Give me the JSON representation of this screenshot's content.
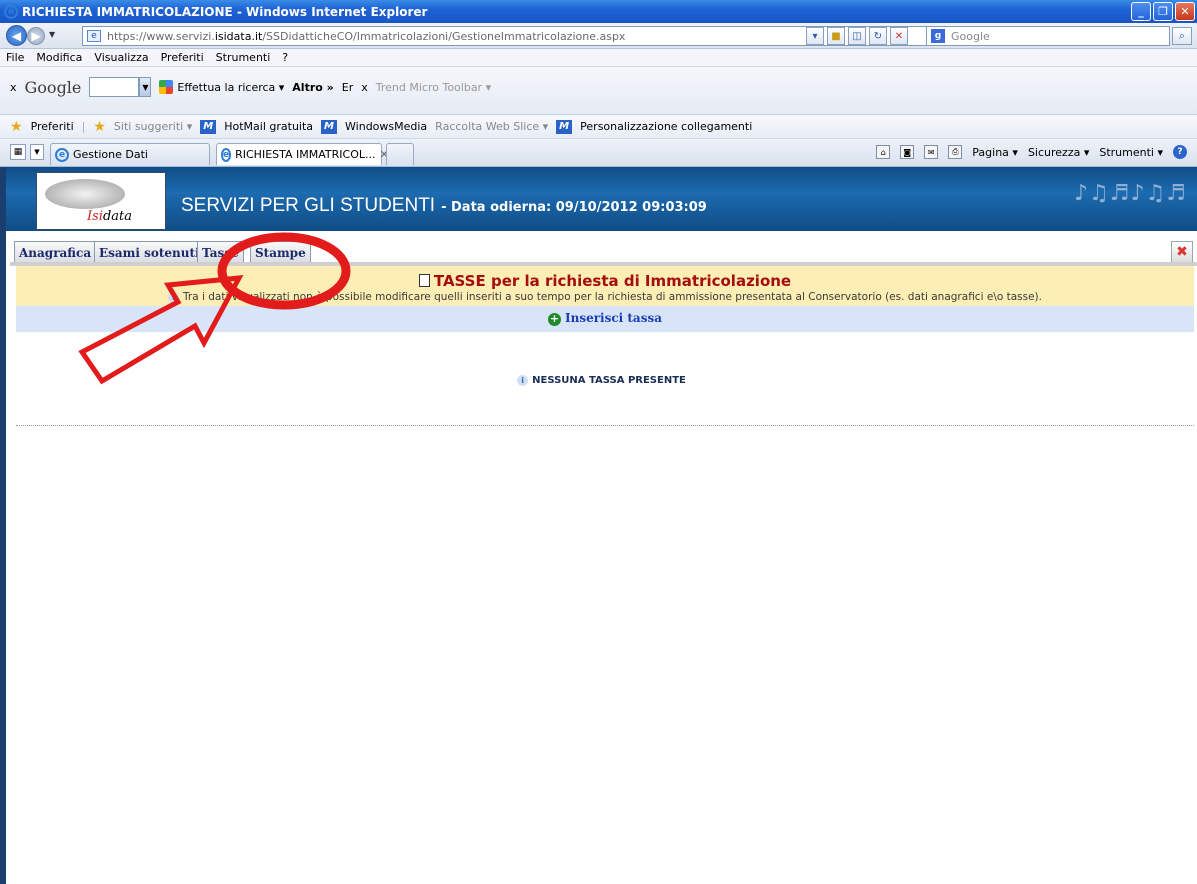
{
  "window": {
    "title": "RICHIESTA IMMATRICOLAZIONE - Windows Internet Explorer",
    "buttons": [
      "_",
      "❐",
      "✕"
    ]
  },
  "address": {
    "url_prefix": "https://www.servizi.",
    "url_domain": "isidata.it",
    "url_path": "/SSDidatticheCO/Immatricolazioni/GestioneImmatricolazione.aspx",
    "search_placeholder": "Google"
  },
  "menu": [
    "File",
    "Modifica",
    "Visualizza",
    "Preferiti",
    "Strumenti",
    "?"
  ],
  "google_toolbar": {
    "close": "x",
    "logo": "Google",
    "search_label": "Effettua la ricerca ▾",
    "altro": "Altro »",
    "er": "Er",
    "x2": "x",
    "trend": "Trend Micro Toolbar ▾"
  },
  "favorites": {
    "preferiti": "Preferiti",
    "items": [
      "Siti suggeriti ▾",
      "HotMail gratuita",
      "WindowsMedia",
      "Raccolta Web Slice ▾",
      "Personalizzazione collegamenti"
    ]
  },
  "tabs": [
    {
      "label": "Gestione Dati"
    },
    {
      "label": "RICHIESTA IMMATRICOL...",
      "close": "✕"
    }
  ],
  "command_bar": {
    "pagina": "Pagina ▾",
    "sicurezza": "Sicurezza ▾",
    "strumenti": "Strumenti ▾",
    "help": "?"
  },
  "page": {
    "logo_left": "Isi",
    "logo_right": "data",
    "banner_title": "SERVIZI PER GLI STUDENTI",
    "banner_date": "- Data odierna: 09/10/2012 09:03:09",
    "tabs": [
      "Anagrafica",
      "Esami sotenuti",
      "Tasse",
      "Stampe"
    ],
    "heading": "TASSE per la richiesta di Immatricolazione",
    "info": "Tra i dati visualizzati non è possibile modificare quelli inseriti a suo tempo per la richiesta di ammissione presentata al Conservatorio (es. dati anagrafici e\\o tasse).",
    "insert_link": "Inserisci tassa",
    "empty_msg": "NESSUNA TASSA PRESENTE"
  }
}
